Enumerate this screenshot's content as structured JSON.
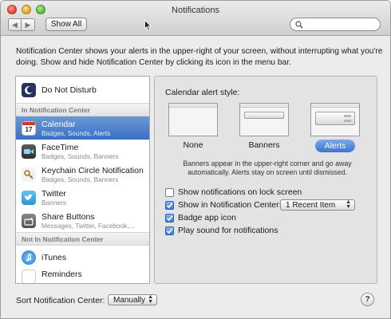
{
  "window": {
    "title": "Notifications"
  },
  "toolbar": {
    "back_label": "◀",
    "forward_label": "▶",
    "show_all_label": "Show All",
    "search_placeholder": ""
  },
  "intro_text": "Notification Center shows your alerts in the upper-right of your screen, without interrupting what you're doing. Show and hide Notification Center by clicking its icon in the menu bar.",
  "sidebar": {
    "do_not_disturb": "Do Not Disturb",
    "in_header": "In Notification Center",
    "not_in_header": "Not In Notification Center",
    "apps": [
      {
        "name": "Calendar",
        "sub": "Badges, Sounds, Alerts",
        "icon": "calendar-icon",
        "badge": "17",
        "selected": true
      },
      {
        "name": "FaceTime",
        "sub": "Badges, Sounds, Banners",
        "icon": "facetime-icon"
      },
      {
        "name": "Keychain Circle Notification",
        "sub": "Badges, Sounds, Banners",
        "icon": "keychain-icon"
      },
      {
        "name": "Twitter",
        "sub": "Banners",
        "icon": "twitter-icon"
      },
      {
        "name": "Share Buttons",
        "sub": "Messages, Twitter, Facebook,...",
        "icon": "share-icon"
      }
    ],
    "not_in_apps": [
      {
        "name": "iTunes",
        "icon": "itunes-icon"
      },
      {
        "name": "Reminders",
        "icon": "reminders-icon"
      }
    ]
  },
  "settings": {
    "alert_style_label": "Calendar alert style:",
    "styles": [
      "None",
      "Banners",
      "Alerts"
    ],
    "selected_style": "Alerts",
    "description": "Banners appear in the upper-right corner and go away automatically. Alerts stay on screen until dismissed.",
    "options": [
      {
        "label": "Show notifications on lock screen",
        "checked": false
      },
      {
        "label": "Show in Notification Center:",
        "checked": true
      },
      {
        "label": "Badge app icon",
        "checked": true
      },
      {
        "label": "Play sound for notifications",
        "checked": true
      }
    ],
    "recent_items_value": "1 Recent Item"
  },
  "footer": {
    "sort_label": "Sort Notification Center:",
    "sort_value": "Manually",
    "help_label": "?"
  },
  "colors": {
    "selection": "#3b6fc2",
    "checkbox_on": "#3f77d3"
  }
}
